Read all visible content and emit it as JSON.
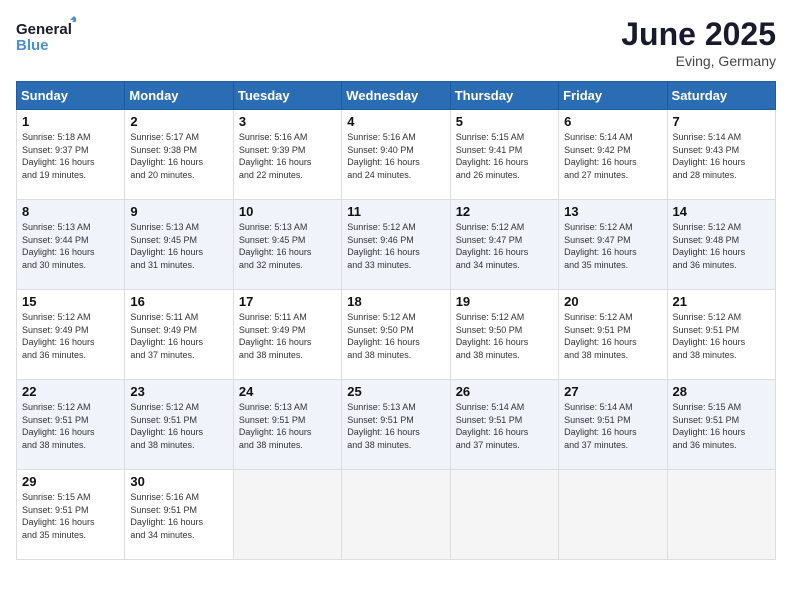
{
  "header": {
    "logo_line1": "General",
    "logo_line2": "Blue",
    "month": "June 2025",
    "location": "Eving, Germany"
  },
  "days_of_week": [
    "Sunday",
    "Monday",
    "Tuesday",
    "Wednesday",
    "Thursday",
    "Friday",
    "Saturday"
  ],
  "weeks": [
    [
      {
        "day": 1,
        "info": "Sunrise: 5:18 AM\nSunset: 9:37 PM\nDaylight: 16 hours\nand 19 minutes."
      },
      {
        "day": 2,
        "info": "Sunrise: 5:17 AM\nSunset: 9:38 PM\nDaylight: 16 hours\nand 20 minutes."
      },
      {
        "day": 3,
        "info": "Sunrise: 5:16 AM\nSunset: 9:39 PM\nDaylight: 16 hours\nand 22 minutes."
      },
      {
        "day": 4,
        "info": "Sunrise: 5:16 AM\nSunset: 9:40 PM\nDaylight: 16 hours\nand 24 minutes."
      },
      {
        "day": 5,
        "info": "Sunrise: 5:15 AM\nSunset: 9:41 PM\nDaylight: 16 hours\nand 26 minutes."
      },
      {
        "day": 6,
        "info": "Sunrise: 5:14 AM\nSunset: 9:42 PM\nDaylight: 16 hours\nand 27 minutes."
      },
      {
        "day": 7,
        "info": "Sunrise: 5:14 AM\nSunset: 9:43 PM\nDaylight: 16 hours\nand 28 minutes."
      }
    ],
    [
      {
        "day": 8,
        "info": "Sunrise: 5:13 AM\nSunset: 9:44 PM\nDaylight: 16 hours\nand 30 minutes."
      },
      {
        "day": 9,
        "info": "Sunrise: 5:13 AM\nSunset: 9:45 PM\nDaylight: 16 hours\nand 31 minutes."
      },
      {
        "day": 10,
        "info": "Sunrise: 5:13 AM\nSunset: 9:45 PM\nDaylight: 16 hours\nand 32 minutes."
      },
      {
        "day": 11,
        "info": "Sunrise: 5:12 AM\nSunset: 9:46 PM\nDaylight: 16 hours\nand 33 minutes."
      },
      {
        "day": 12,
        "info": "Sunrise: 5:12 AM\nSunset: 9:47 PM\nDaylight: 16 hours\nand 34 minutes."
      },
      {
        "day": 13,
        "info": "Sunrise: 5:12 AM\nSunset: 9:47 PM\nDaylight: 16 hours\nand 35 minutes."
      },
      {
        "day": 14,
        "info": "Sunrise: 5:12 AM\nSunset: 9:48 PM\nDaylight: 16 hours\nand 36 minutes."
      }
    ],
    [
      {
        "day": 15,
        "info": "Sunrise: 5:12 AM\nSunset: 9:49 PM\nDaylight: 16 hours\nand 36 minutes."
      },
      {
        "day": 16,
        "info": "Sunrise: 5:11 AM\nSunset: 9:49 PM\nDaylight: 16 hours\nand 37 minutes."
      },
      {
        "day": 17,
        "info": "Sunrise: 5:11 AM\nSunset: 9:49 PM\nDaylight: 16 hours\nand 38 minutes."
      },
      {
        "day": 18,
        "info": "Sunrise: 5:12 AM\nSunset: 9:50 PM\nDaylight: 16 hours\nand 38 minutes."
      },
      {
        "day": 19,
        "info": "Sunrise: 5:12 AM\nSunset: 9:50 PM\nDaylight: 16 hours\nand 38 minutes."
      },
      {
        "day": 20,
        "info": "Sunrise: 5:12 AM\nSunset: 9:51 PM\nDaylight: 16 hours\nand 38 minutes."
      },
      {
        "day": 21,
        "info": "Sunrise: 5:12 AM\nSunset: 9:51 PM\nDaylight: 16 hours\nand 38 minutes."
      }
    ],
    [
      {
        "day": 22,
        "info": "Sunrise: 5:12 AM\nSunset: 9:51 PM\nDaylight: 16 hours\nand 38 minutes."
      },
      {
        "day": 23,
        "info": "Sunrise: 5:12 AM\nSunset: 9:51 PM\nDaylight: 16 hours\nand 38 minutes."
      },
      {
        "day": 24,
        "info": "Sunrise: 5:13 AM\nSunset: 9:51 PM\nDaylight: 16 hours\nand 38 minutes."
      },
      {
        "day": 25,
        "info": "Sunrise: 5:13 AM\nSunset: 9:51 PM\nDaylight: 16 hours\nand 38 minutes."
      },
      {
        "day": 26,
        "info": "Sunrise: 5:14 AM\nSunset: 9:51 PM\nDaylight: 16 hours\nand 37 minutes."
      },
      {
        "day": 27,
        "info": "Sunrise: 5:14 AM\nSunset: 9:51 PM\nDaylight: 16 hours\nand 37 minutes."
      },
      {
        "day": 28,
        "info": "Sunrise: 5:15 AM\nSunset: 9:51 PM\nDaylight: 16 hours\nand 36 minutes."
      }
    ],
    [
      {
        "day": 29,
        "info": "Sunrise: 5:15 AM\nSunset: 9:51 PM\nDaylight: 16 hours\nand 35 minutes."
      },
      {
        "day": 30,
        "info": "Sunrise: 5:16 AM\nSunset: 9:51 PM\nDaylight: 16 hours\nand 34 minutes."
      },
      null,
      null,
      null,
      null,
      null
    ]
  ]
}
